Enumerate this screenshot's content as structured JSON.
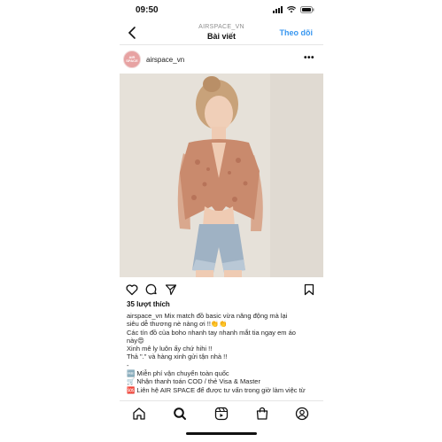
{
  "status": {
    "time": "09:50"
  },
  "header": {
    "subtitle": "AIRSPACE_VN",
    "title": "Bài viết",
    "follow_label": "Theo dõi"
  },
  "post": {
    "avatar_text": "AIR SPACE",
    "username": "airspace_vn",
    "more": "•••",
    "likes": "35 lượt thích",
    "caption": {
      "line1_user": "airspace_vn",
      "line1": " Mix match đồ basic vừa năng động mà lại",
      "line2": "siêu dễ thương nè nàng ơi !!👏👏",
      "line3": "Các tín đồ của boho nhanh tay nhanh mắt tia ngay em áo",
      "line4": "này😍",
      "line5": "Xinh mê ly luôn ấy chứ hihi !!",
      "line6": "Thả \".\" và hàng xinh gửi tận nhà !!",
      "line7": "-",
      "line8": "🆓 Miễn phí vận chuyển toàn quốc",
      "line9": "🛒 Nhận thanh toán COD / thẻ Visa & Master",
      "line10": "🆘 Liên hệ AIR SPACE để được tư vấn trong giờ làm việc từ"
    }
  },
  "icons": {
    "back": "chevron-left-icon",
    "like": "heart-icon",
    "comment": "comment-icon",
    "share": "send-icon",
    "save": "bookmark-icon",
    "nav": [
      "home-icon",
      "search-icon",
      "add-icon",
      "shop-icon",
      "profile-icon"
    ]
  },
  "colors": {
    "accent": "#3897f0",
    "avatar": "#e7a2a2"
  }
}
